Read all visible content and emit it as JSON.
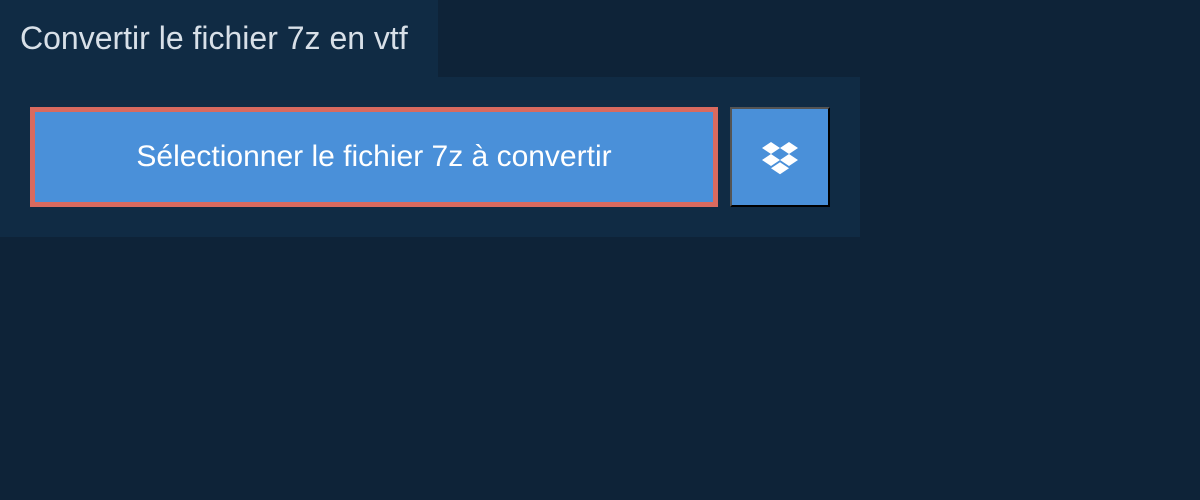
{
  "header": {
    "title": "Convertir le fichier 7z en vtf"
  },
  "actions": {
    "select_file_label": "Sélectionner le fichier 7z à convertir"
  }
}
